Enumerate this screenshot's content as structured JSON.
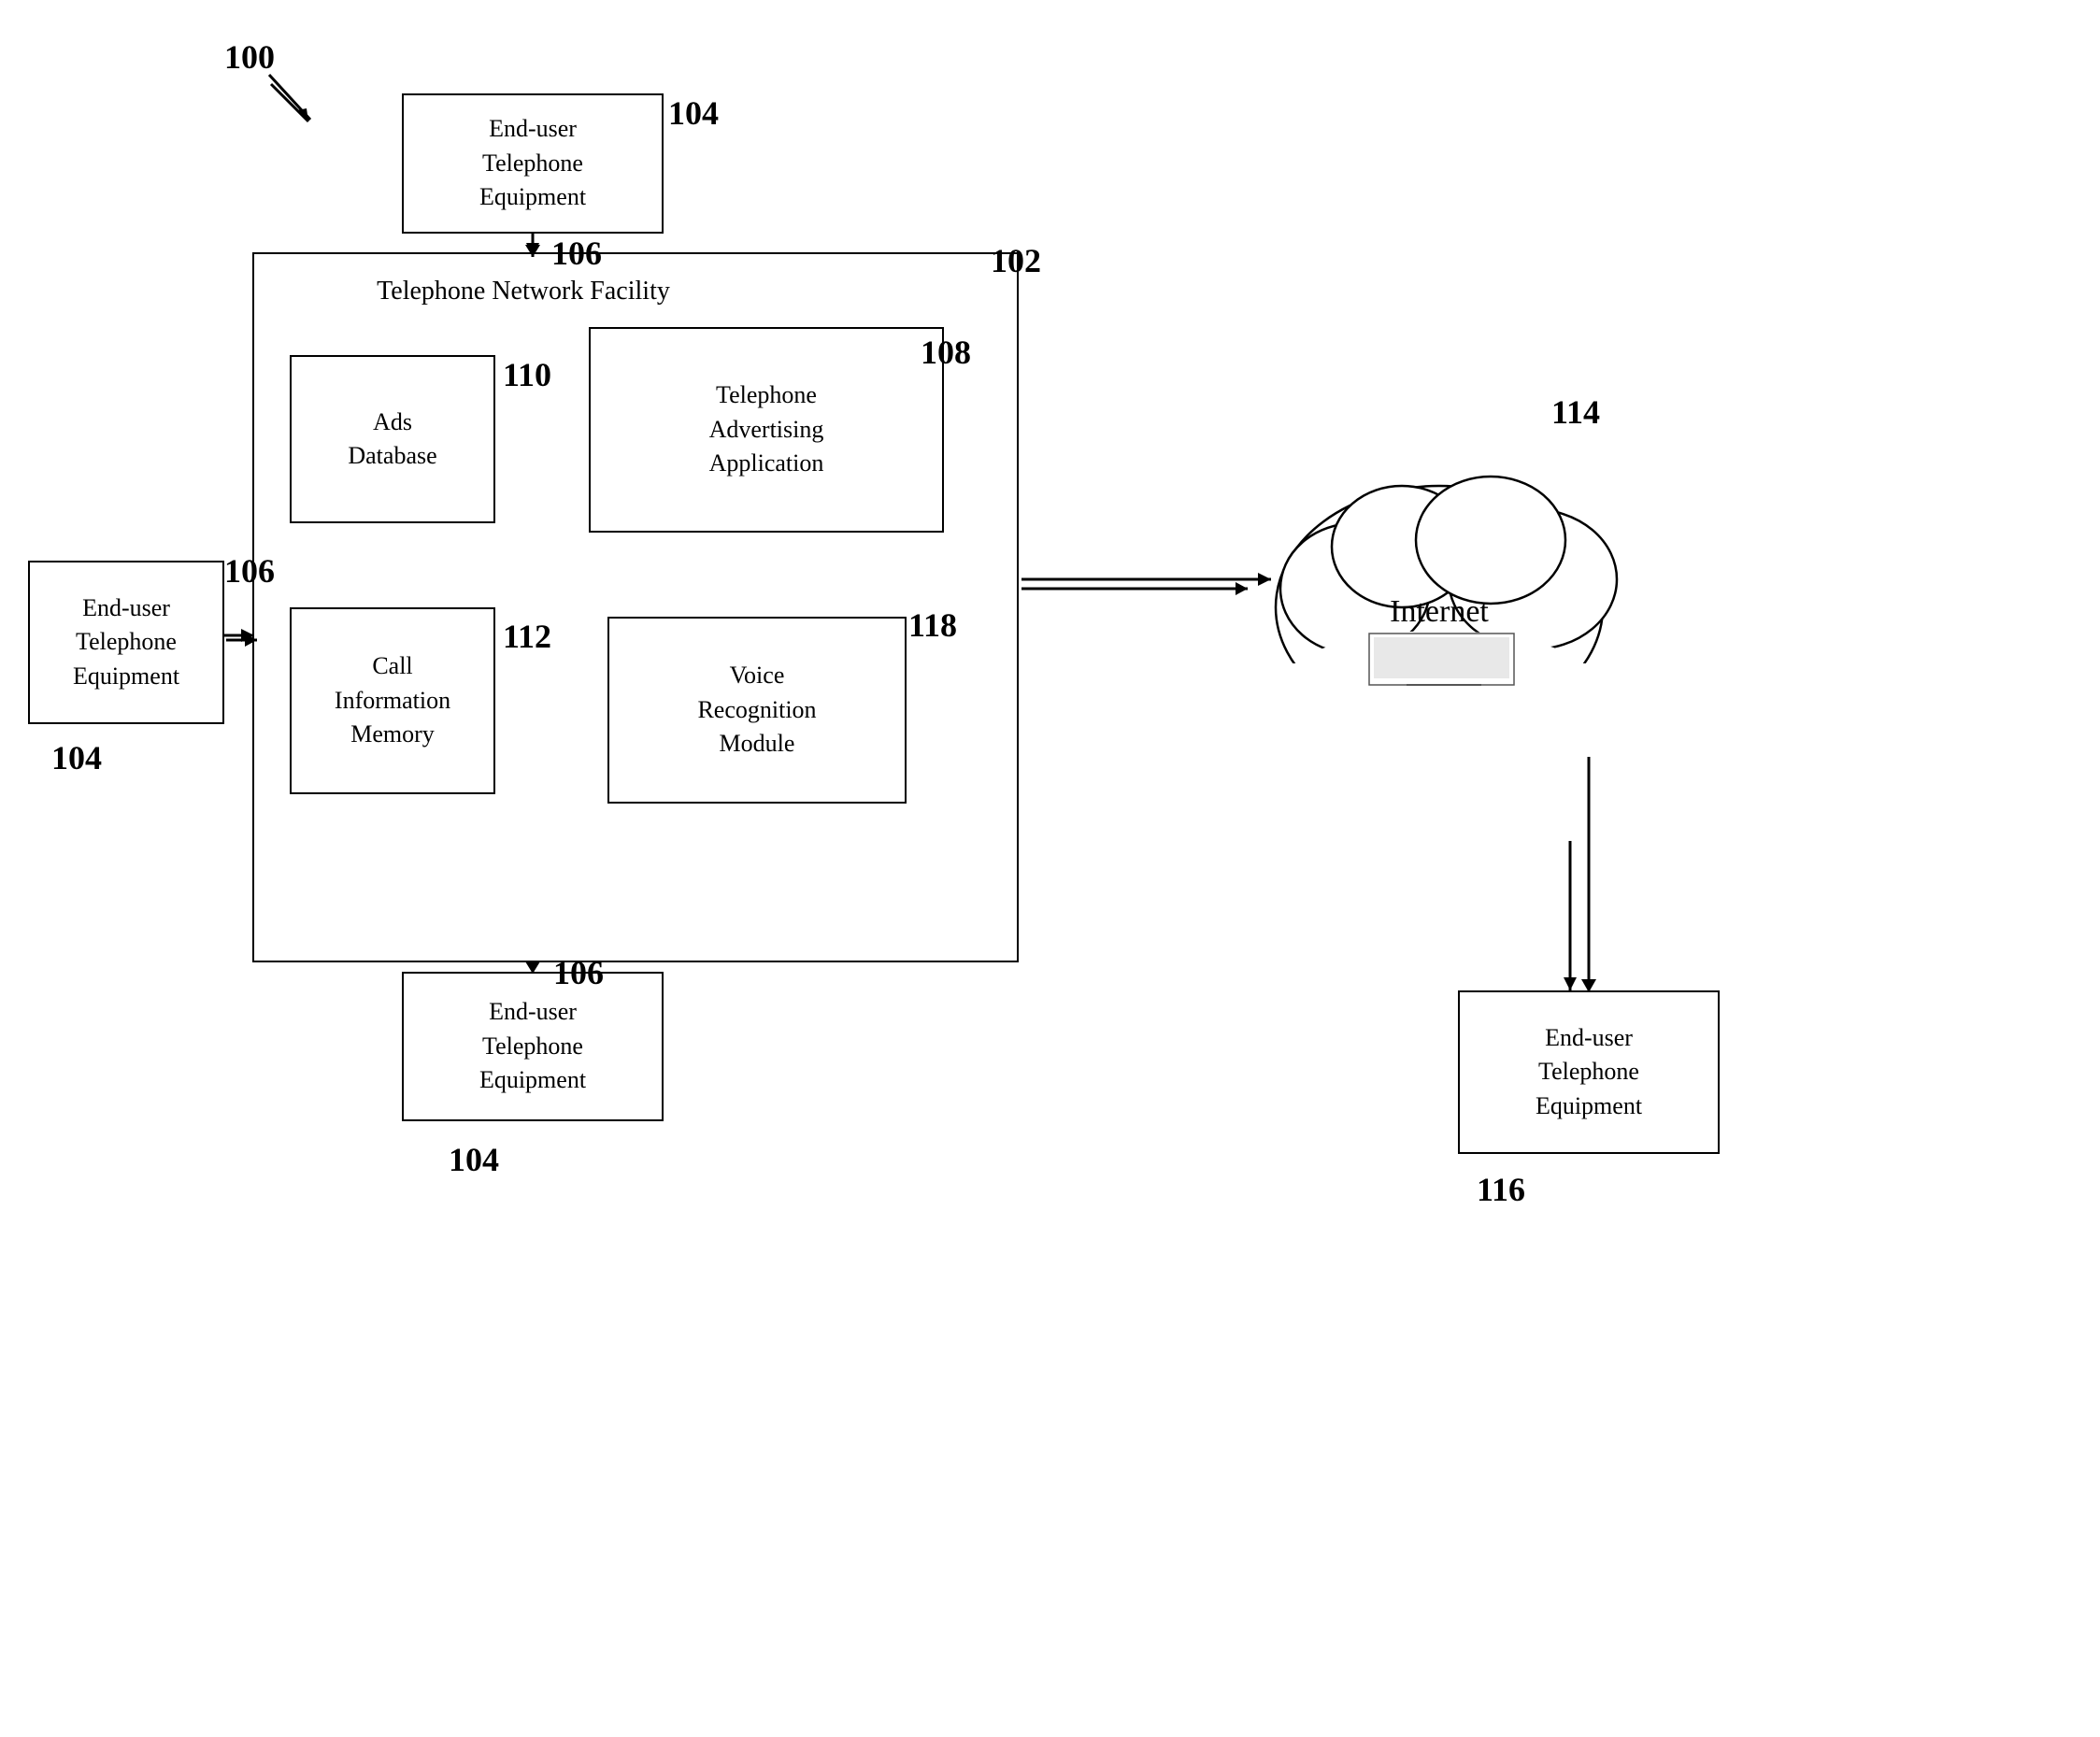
{
  "diagram": {
    "title": "100",
    "nodes": {
      "tnf": {
        "label": "Telephone Network Facility",
        "ref": "102"
      },
      "end_user_top": {
        "label": "End-user\nTelephone\nEquipment",
        "ref": "104",
        "connection_ref": "106"
      },
      "end_user_left": {
        "label": "End-user\nTelephone\nEquipment",
        "ref": "104",
        "connection_ref": "106"
      },
      "end_user_bottom": {
        "label": "End-user\nTelephone\nEquipment",
        "ref": "104",
        "connection_ref": "106"
      },
      "end_user_right": {
        "label": "End-user\nTelephone\nEquipment",
        "ref": "116"
      },
      "ads_database": {
        "label": "Ads\nDatabase",
        "ref": "110"
      },
      "telephone_advertising": {
        "label": "Telephone\nAdvertising\nApplication",
        "ref": "108"
      },
      "call_information": {
        "label": "Call\nInformation\nMemory",
        "ref": "112"
      },
      "voice_recognition": {
        "label": "Voice\nRecognition\nModule",
        "ref": "118"
      },
      "internet": {
        "label": "Internet",
        "ref": "114"
      }
    }
  }
}
